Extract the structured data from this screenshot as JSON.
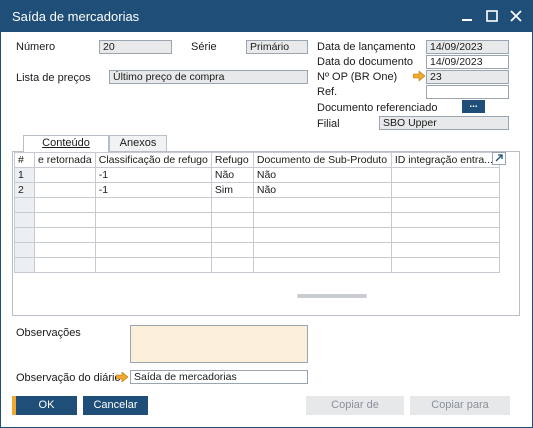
{
  "window": {
    "title": "Saída de mercadorias"
  },
  "header": {
    "numero_label": "Número",
    "numero_value": "20",
    "serie_label": "Série",
    "serie_value": "Primário",
    "lista_precos_label": "Lista de preços",
    "lista_precos_value": "Último preço de compra",
    "data_lancamento_label": "Data de lançamento",
    "data_lancamento_value": "14/09/2023",
    "data_documento_label": "Data do documento",
    "data_documento_value": "14/09/2023",
    "nop_label": "Nº OP (BR One)",
    "nop_value": "23",
    "ref_label": "Ref.",
    "ref_value": "",
    "doc_ref_label": "Documento referenciado",
    "doc_ref_button": "...",
    "filial_label": "Filial",
    "filial_value": "SBO Upper"
  },
  "tabs": [
    {
      "label": "Conteúdo",
      "active": true
    },
    {
      "label": "Anexos",
      "active": false
    }
  ],
  "grid": {
    "columns": [
      "#",
      "e retornada",
      "Classificação de refugo",
      "Refugo",
      "Documento de Sub-Produto",
      "ID integração entra..."
    ],
    "rows": [
      [
        "1",
        "",
        "-1",
        "Não",
        "Não",
        ""
      ],
      [
        "2",
        "",
        "-1",
        "Sim",
        "Não",
        ""
      ]
    ]
  },
  "footer": {
    "observacoes_label": "Observações",
    "observacoes_value": "",
    "observacao_diario_label": "Observação do diário",
    "observacao_diario_value": "Saída de mercadorias"
  },
  "buttons": {
    "ok": "OK",
    "cancel": "Cancelar",
    "copy_from": "Copiar de",
    "copy_to": "Copiar para"
  },
  "colors": {
    "title_bar": "#1f4e78",
    "accent_orange": "#f0a830",
    "notes_background": "#fcefd9"
  },
  "icons": {
    "link_arrow": "orange-right-arrow-icon",
    "grid_expand": "expand-arrow-icon"
  }
}
